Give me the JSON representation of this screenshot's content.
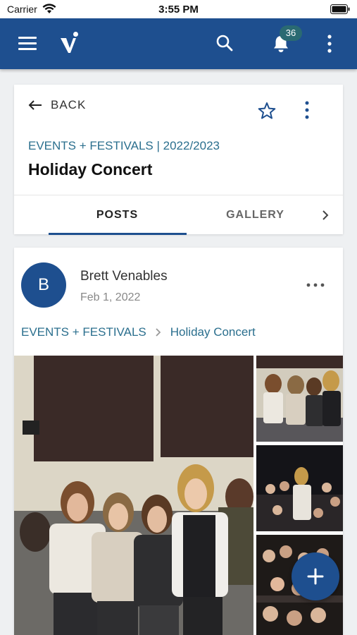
{
  "status_bar": {
    "carrier": "Carrier",
    "time": "3:55 PM"
  },
  "header": {
    "notification_count": "36",
    "brand_color": "#1e4f8f"
  },
  "event": {
    "back_label": "BACK",
    "breadcrumb": "EVENTS + FESTIVALS | 2022/2023",
    "title": "Holiday Concert",
    "tabs": [
      {
        "label": "POSTS",
        "active": true
      },
      {
        "label": "GALLERY",
        "active": false
      }
    ]
  },
  "post": {
    "avatar_initial": "B",
    "author": "Brett Venables",
    "date": "Feb 1, 2022",
    "breadcrumb": [
      "EVENTS + FESTIVALS",
      "Holiday Concert"
    ]
  },
  "icons": [
    "wifi-icon",
    "battery-icon",
    "menu-icon",
    "logo-icon",
    "search-icon",
    "bell-icon",
    "kebab-icon",
    "back-arrow-icon",
    "star-icon",
    "chevron-right-icon",
    "more-horizontal-icon",
    "plus-icon"
  ]
}
